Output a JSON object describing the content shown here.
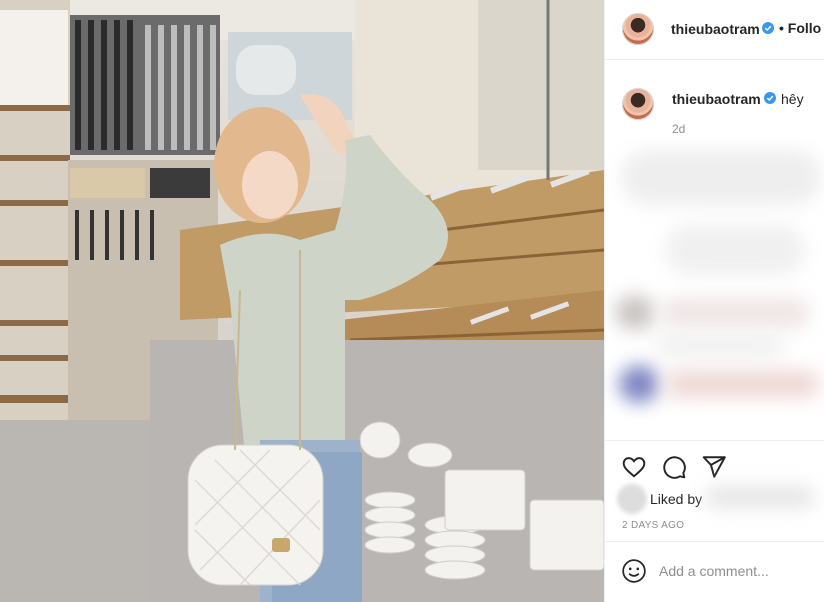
{
  "post": {
    "photo_description_icon": "photo-post",
    "author": "thieubaotram",
    "follow_label": "• Follo",
    "verified_color": "#3897f0"
  },
  "caption": {
    "author": "thieubaotram",
    "text": "hêy",
    "time": "2d"
  },
  "actions": {
    "like_icon": "heart-icon",
    "comment_icon": "comment-icon",
    "share_icon": "share-icon",
    "liked_by_label": "Liked by"
  },
  "date": "2 DAYS AGO",
  "comment": {
    "emoji_icon": "smiley-icon",
    "placeholder": "Add a comment..."
  }
}
